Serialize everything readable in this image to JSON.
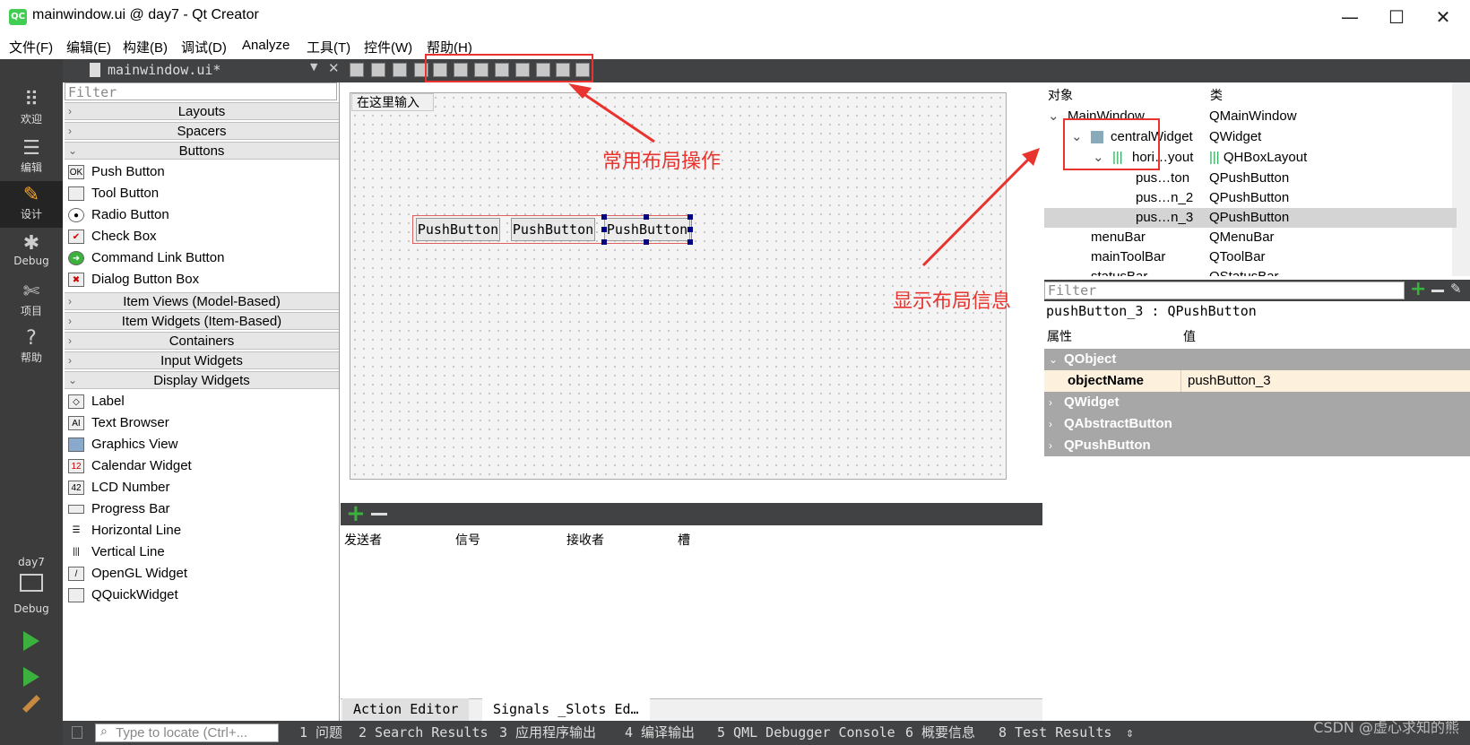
{
  "window": {
    "title": "mainwindow.ui @ day7 - Qt Creator",
    "app_icon_text": "QC",
    "minimize": "—",
    "maximize": "☐",
    "close": "✕"
  },
  "menubar": [
    "文件(F)",
    "编辑(E)",
    "构建(B)",
    "调试(D)",
    "Analyze",
    "工具(T)",
    "控件(W)",
    "帮助(H)"
  ],
  "modes": [
    {
      "label": "欢迎",
      "icon": "grid-icon",
      "glyph": "⠿"
    },
    {
      "label": "编辑",
      "icon": "document-icon",
      "glyph": "☰"
    },
    {
      "label": "设计",
      "icon": "pencil-icon",
      "glyph": "✎"
    },
    {
      "label": "Debug",
      "icon": "bug-icon",
      "glyph": "✱"
    },
    {
      "label": "项目",
      "icon": "wrench-icon",
      "glyph": "✄"
    },
    {
      "label": "帮助",
      "icon": "help-icon",
      "glyph": "?"
    }
  ],
  "kit": {
    "project": "day7",
    "config": "Debug"
  },
  "editor": {
    "document": "mainwindow.ui*"
  },
  "widget_box": {
    "filter_placeholder": "Filter",
    "categories": {
      "layouts": "Layouts",
      "spacers": "Spacers",
      "buttons": "Buttons",
      "item_views": "Item Views (Model-Based)",
      "item_widgets": "Item Widgets (Item-Based)",
      "containers": "Containers",
      "input_widgets": "Input Widgets",
      "display_widgets": "Display Widgets"
    },
    "buttons": [
      "Push Button",
      "Tool Button",
      "Radio Button",
      "Check Box",
      "Command Link Button",
      "Dialog Button Box"
    ],
    "display": [
      "Label",
      "Text Browser",
      "Graphics View",
      "Calendar Widget",
      "LCD Number",
      "Progress Bar",
      "Horizontal Line",
      "Vertical Line",
      "OpenGL Widget",
      "QQuickWidget"
    ]
  },
  "form": {
    "menu_placeholder": "在这里输入",
    "buttons": [
      "PushButton",
      "PushButton",
      "PushButton"
    ]
  },
  "signals_slots": {
    "headers": [
      "发送者",
      "信号",
      "接收者",
      "槽"
    ],
    "tabs": [
      "Action Editor",
      "Signals _Slots Ed…"
    ]
  },
  "object_inspector": {
    "headers": [
      "对象",
      "类"
    ],
    "rows": [
      {
        "name": "MainWindow",
        "class": "QMainWindow"
      },
      {
        "name": "centralWidget",
        "class": "QWidget"
      },
      {
        "name": "hori…yout",
        "class": "QHBoxLayout"
      },
      {
        "name": "pus…ton",
        "class": "QPushButton"
      },
      {
        "name": "pus…n_2",
        "class": "QPushButton"
      },
      {
        "name": "pus…n_3",
        "class": "QPushButton"
      },
      {
        "name": "menuBar",
        "class": "QMenuBar"
      },
      {
        "name": "mainToolBar",
        "class": "QToolBar"
      },
      {
        "name": "statusBar",
        "class": "QStatusBar"
      }
    ]
  },
  "property_editor": {
    "filter_placeholder": "Filter",
    "object_line": "pushButton_3 : QPushButton",
    "headers": [
      "属性",
      "值"
    ],
    "groups": [
      "QObject",
      "QWidget",
      "QAbstractButton",
      "QPushButton"
    ],
    "object_name": {
      "prop": "objectName",
      "value": "pushButton_3"
    }
  },
  "statusbar": {
    "locate_placeholder": "Type to locate (Ctrl+...",
    "items": [
      "1 问题",
      "2 Search Results",
      "3 应用程序输出",
      "4 编译输出",
      "5 QML Debugger Console",
      "6 概要信息",
      "8 Test Results"
    ]
  },
  "annotations": {
    "layout_ops": "常用布局操作",
    "layout_info": "显示布局信息"
  },
  "watermark": "CSDN @虚心求知的熊",
  "colors": {
    "annotation": "#e8332e",
    "dark_panel": "#404244",
    "mode_bar": "#3c3c3c",
    "group_header": "#a7a7a7"
  }
}
